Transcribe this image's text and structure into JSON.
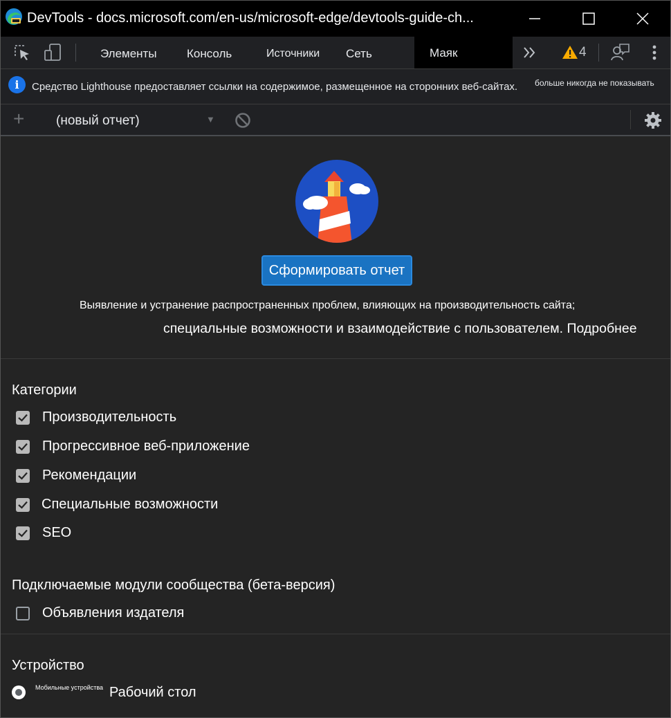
{
  "window": {
    "title": "DevTools - docs.microsoft.com/en-us/microsoft-edge/devtools-guide-ch..."
  },
  "tabs": [
    {
      "label": "Элементы"
    },
    {
      "label": "Консоль"
    },
    {
      "label": "Источники"
    },
    {
      "label": "Сеть"
    },
    {
      "label": "Маяк",
      "active": true
    }
  ],
  "toolbar": {
    "warning_count": "4"
  },
  "infobar": {
    "message": "Средство Lighthouse предоставляет ссылки на содержимое, размещенное на сторонних веб-сайтах.",
    "dismiss_label": "больше никогда не показывать"
  },
  "report": {
    "selected": "(новый отчет)"
  },
  "main": {
    "generate_button": "Сформировать отчет",
    "description_line1": "Выявление и устранение распространенных проблем, влияющих на производительность сайта;",
    "description_line2": "специальные возможности и взаимодействие с пользователем. Подробнее"
  },
  "categories": {
    "title": "Категории",
    "items": [
      {
        "label": "Производительность",
        "checked": true
      },
      {
        "label": "Прогрессивное веб-приложение",
        "checked": true
      },
      {
        "label": "Рекомендации",
        "checked": true
      },
      {
        "label": "Специальные возможности",
        "checked": true
      },
      {
        "label": "SEO",
        "checked": true
      }
    ]
  },
  "plugins": {
    "title": "Подключаемые модули сообщества (бета-версия)",
    "items": [
      {
        "label": "Объявления издателя",
        "checked": false
      }
    ]
  },
  "device": {
    "title": "Устройство",
    "mobile_label": "Мобильные устройства",
    "desktop_label": "Рабочий стол"
  },
  "colors": {
    "accent": "#1a73c2",
    "background": "#242424",
    "warning": "#f9ab00"
  }
}
